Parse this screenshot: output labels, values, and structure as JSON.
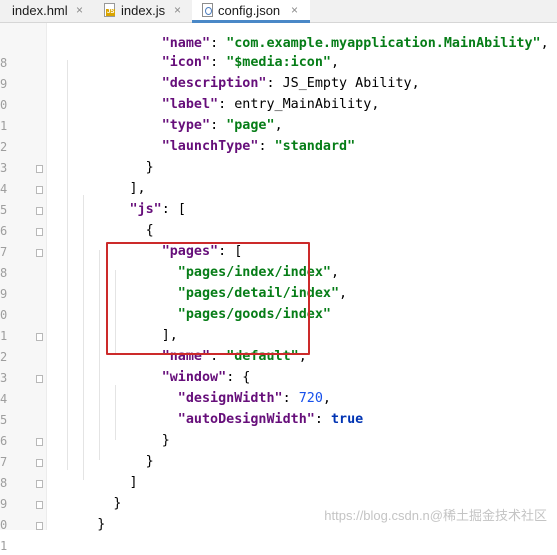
{
  "tabs": [
    {
      "label": "index.hml",
      "close": "×",
      "icon": "html-file-icon",
      "active": false
    },
    {
      "label": "index.js",
      "close": "×",
      "icon": "js-file-icon",
      "active": false
    },
    {
      "label": "config.json",
      "close": "×",
      "icon": "json-file-icon",
      "active": true
    }
  ],
  "editor": {
    "line_number_digits": [
      "",
      "8",
      "9",
      "0",
      "1",
      "2",
      "3",
      "4",
      "5",
      "6",
      "7",
      "8",
      "9",
      "0",
      "1",
      "2",
      "3",
      "4",
      "5",
      "6",
      "7",
      "8",
      "9",
      "0",
      "1"
    ],
    "lines": [
      [
        {
          "t": "\"name\"",
          "c": "key"
        },
        {
          "t": ": ",
          "c": "p"
        },
        {
          "t": "\"com.example.myapplication.MainAbility\"",
          "c": "str"
        },
        {
          "t": ",",
          "c": "p"
        }
      ],
      [
        {
          "t": "\"icon\"",
          "c": "key"
        },
        {
          "t": ": ",
          "c": "p"
        },
        {
          "t": "\"$media:icon\"",
          "c": "str"
        },
        {
          "t": ",",
          "c": "p"
        }
      ],
      [
        {
          "t": "\"description\"",
          "c": "key"
        },
        {
          "t": ": ",
          "c": "p"
        },
        {
          "t": "JS_Empty Ability",
          "c": "p"
        },
        {
          "t": ",",
          "c": "p"
        }
      ],
      [
        {
          "t": "\"label\"",
          "c": "key"
        },
        {
          "t": ": ",
          "c": "p"
        },
        {
          "t": "entry_MainAbility",
          "c": "p"
        },
        {
          "t": ",",
          "c": "p"
        }
      ],
      [
        {
          "t": "\"type\"",
          "c": "key"
        },
        {
          "t": ": ",
          "c": "p"
        },
        {
          "t": "\"page\"",
          "c": "str"
        },
        {
          "t": ",",
          "c": "p"
        }
      ],
      [
        {
          "t": "\"launchType\"",
          "c": "key"
        },
        {
          "t": ": ",
          "c": "p"
        },
        {
          "t": "\"standard\"",
          "c": "str"
        }
      ],
      [
        {
          "t": "}",
          "c": "p"
        }
      ],
      [
        {
          "t": "],",
          "c": "p"
        }
      ],
      [
        {
          "t": "\"js\"",
          "c": "key"
        },
        {
          "t": ": [",
          "c": "p"
        }
      ],
      [
        {
          "t": "{",
          "c": "p"
        }
      ],
      [
        {
          "t": "\"pages\"",
          "c": "key"
        },
        {
          "t": ": [",
          "c": "p"
        }
      ],
      [
        {
          "t": "\"pages/index/index\"",
          "c": "str"
        },
        {
          "t": ",",
          "c": "p"
        }
      ],
      [
        {
          "t": "\"pages/detail/index\"",
          "c": "str"
        },
        {
          "t": ",",
          "c": "p"
        }
      ],
      [
        {
          "t": "\"pages/goods/index\"",
          "c": "str"
        }
      ],
      [
        {
          "t": "],",
          "c": "p"
        }
      ],
      [
        {
          "t": "\"name\"",
          "c": "key"
        },
        {
          "t": ": ",
          "c": "p"
        },
        {
          "t": "\"default\"",
          "c": "str"
        },
        {
          "t": ",",
          "c": "p"
        }
      ],
      [
        {
          "t": "\"window\"",
          "c": "key"
        },
        {
          "t": ": {",
          "c": "p"
        }
      ],
      [
        {
          "t": "\"designWidth\"",
          "c": "key"
        },
        {
          "t": ": ",
          "c": "p"
        },
        {
          "t": "720",
          "c": "num"
        },
        {
          "t": ",",
          "c": "p"
        }
      ],
      [
        {
          "t": "\"autoDesignWidth\"",
          "c": "key"
        },
        {
          "t": ": ",
          "c": "p"
        },
        {
          "t": "true",
          "c": "kw"
        }
      ],
      [
        {
          "t": "}",
          "c": "p"
        }
      ],
      [
        {
          "t": "}",
          "c": "p"
        }
      ],
      [
        {
          "t": "]",
          "c": "p"
        }
      ],
      [
        {
          "t": "}",
          "c": "p"
        }
      ],
      [
        {
          "t": "}",
          "c": "p"
        }
      ]
    ]
  },
  "highlight_color": "#cc2a2a",
  "watermark": "https://blog.csdn.n@稀土掘金技术社区"
}
